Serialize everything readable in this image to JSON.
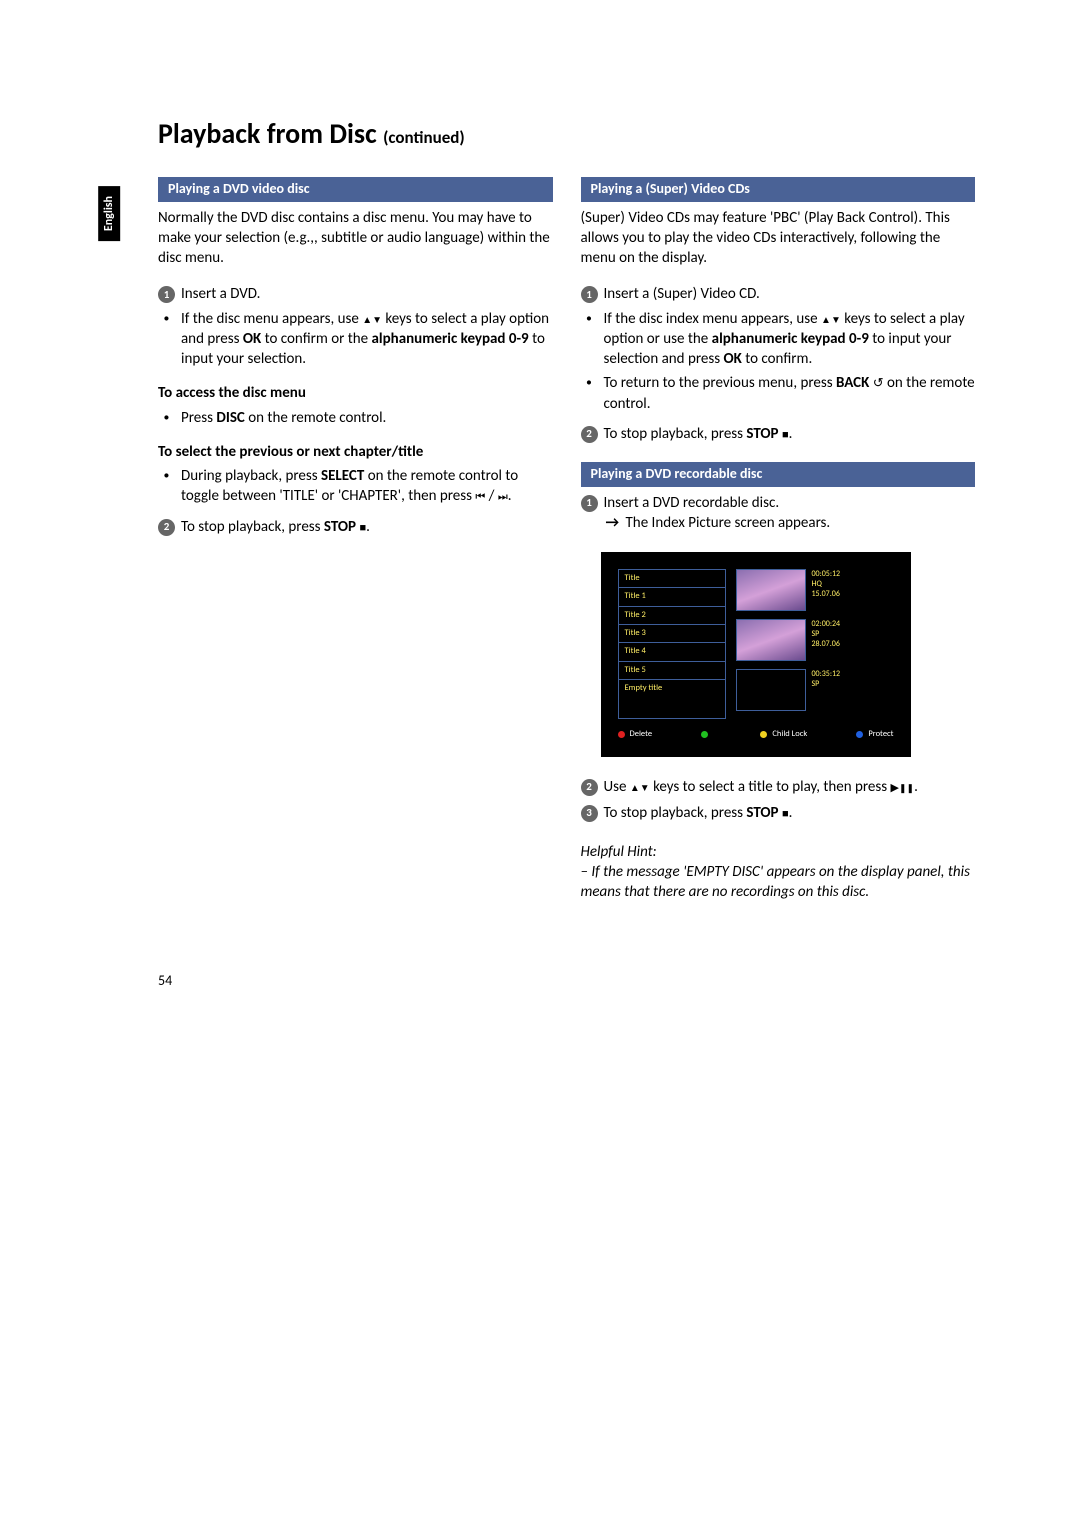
{
  "language_tab": "English",
  "page_title_main": "Playback from Disc",
  "page_title_cont": "(continued)",
  "page_number": "54",
  "left": {
    "header": "Playing a DVD video disc",
    "intro": "Normally the DVD disc contains a disc menu. You may have to make your selection (e.g.,, subtitle or audio language) within the disc menu.",
    "step1": "Insert a DVD.",
    "bullet1_a": "If the disc menu appears, use ",
    "bullet1_b": " keys to select a play option and press ",
    "bullet1_ok": "OK",
    "bullet1_c": " to confirm or the ",
    "bullet1_kp": "alphanumeric keypad 0-9",
    "bullet1_d": " to input your selection.",
    "sub1": "To access the disc menu",
    "sub1_b1_a": "Press ",
    "sub1_b1_disc": "DISC",
    "sub1_b1_b": " on the remote control.",
    "sub2": "To select the previous or next chapter/title",
    "sub2_b1_a": "During playback, press ",
    "sub2_b1_sel": "SELECT",
    "sub2_b1_b": " on the remote control to toggle between 'TITLE' or 'CHAPTER', then press ",
    "step2_a": "To stop playback, press ",
    "step2_stop": "STOP"
  },
  "right1": {
    "header": "Playing a (Super) Video CDs",
    "intro": "(Super) Video CDs may feature 'PBC' (Play Back Control). This allows you to play the video CDs interactively, following the menu on the display.",
    "step1": "Insert a (Super) Video CD.",
    "bullet1_a": "If the disc index menu appears, use ",
    "bullet1_b": " keys to select a play option or use the ",
    "bullet1_kp": "alphanumeric keypad 0-9",
    "bullet1_c": " to input your selection and press ",
    "bullet1_ok": "OK",
    "bullet1_d": " to confirm.",
    "bullet2_a": "To return to the previous menu, press ",
    "bullet2_back": "BACK",
    "bullet2_b": " on the remote control.",
    "step2_a": "To stop playback, press ",
    "step2_stop": "STOP"
  },
  "right2": {
    "header": "Playing a DVD recordable disc",
    "step1": "Insert a DVD recordable disc.",
    "step1_res": "The Index Picture screen appears.",
    "step2_a": "Use ",
    "step2_b": " keys to select a title to play, then press ",
    "step3_a": "To stop playback, press ",
    "step3_stop": "STOP",
    "hint_head": "Helpful Hint:",
    "hint_body": "– If the message 'EMPTY DISC' appears on the display panel, this means that there are no recordings on this disc."
  },
  "screenshot": {
    "title_header": "Title",
    "titles": [
      "Title 1",
      "Title 2",
      "Title 3",
      "Title 4",
      "Title 5",
      "Empty title"
    ],
    "thumbs": [
      {
        "time": "00:05:12",
        "quality": "HQ",
        "date": "15.07.06"
      },
      {
        "time": "02:00:24",
        "quality": "SP",
        "date": "28.07.06"
      },
      {
        "time": "00:35:12",
        "quality": "SP",
        "date": ""
      }
    ],
    "footer_delete": "Delete",
    "footer_childlock": "Child Lock",
    "footer_protect": "Protect"
  }
}
